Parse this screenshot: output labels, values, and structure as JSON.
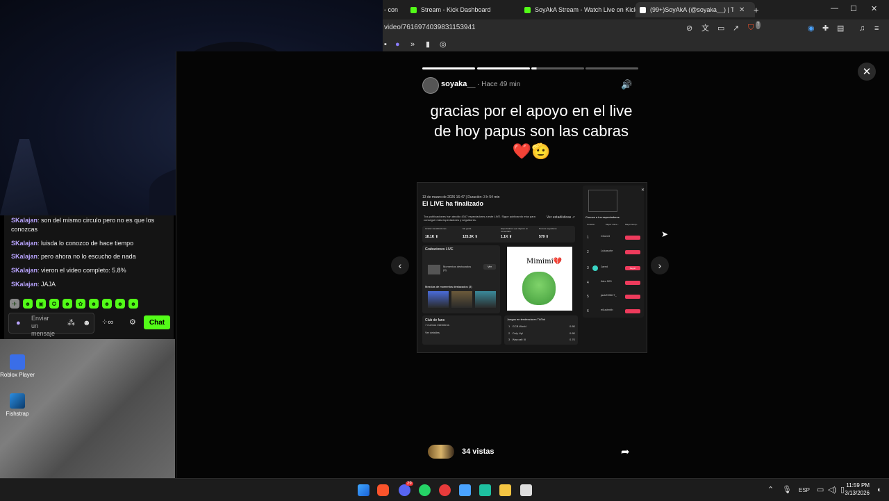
{
  "browser": {
    "tabs": [
      {
        "label": "- con"
      },
      {
        "label": "Stream - Kick Dashboard"
      },
      {
        "label": "SoyAkA Stream - Watch Live on Kick"
      },
      {
        "label": "(99+)SoyAkA (@soyaka__) | TikT"
      }
    ],
    "url": "video/7616974039831153941",
    "shield_badge": "7"
  },
  "chat": {
    "messages": [
      {
        "user": "SKalajan",
        "text": ": son del mismo circulo pero no es que los conozcas"
      },
      {
        "user": "SKalajan",
        "text": ": luisda lo conozco de hace tiempo"
      },
      {
        "user": "SKalajan",
        "text": ": pero ahora no lo escucho de nada"
      },
      {
        "user": "SKalajan",
        "text": ": vieron el video completo: 5.8%"
      },
      {
        "user": "SKalajan",
        "text": ": JAJA"
      }
    ],
    "input_placeholder": "Enviar un mensaje",
    "send_label": "Chat"
  },
  "desktop": {
    "icons": [
      {
        "label": "Roblox Player"
      },
      {
        "label": "Fishstrap"
      }
    ]
  },
  "story": {
    "username": "soyaka__",
    "time": "· Hace 49 min",
    "caption": "gracias por el apoyo en el live de hoy papus son las cabras ❤️🫡",
    "views": "34 vistas",
    "progress": [
      1,
      1,
      0.1,
      0
    ]
  },
  "embedded": {
    "date": "13 de marzo de 2026 16:47 | Duración: 3 h 54 min",
    "title": "El LIVE ha finalizado",
    "summary": "Tus publicaciones han atraído 4347 espectadores a este LIVE. Sigue publicando más para conseguir más espectadores y seguidores.",
    "stats_link": "Ver estadísticas ↗",
    "stats": [
      {
        "label": "Ocultar visualizaciones",
        "value": "18.1K ⬆"
      },
      {
        "label": "Me gusta",
        "value": "125.3K ⬆"
      },
      {
        "label": "Espectadores que dejaron un comentario",
        "value": "1.1K ⬆"
      },
      {
        "label": "Nuevos seguidores",
        "value": "579 ⬆"
      }
    ],
    "recordings_title": "Grabaciones LIVE",
    "moments_label": "Momentos destacados (0)",
    "view_btn": "Ver",
    "mixes_title": "Mezclas de momentos destacados (3)",
    "sticker_text": "Mimimi💔",
    "fans_title": "Club de fans",
    "fans_sub": "7 nuevos miembros",
    "fans_link": "Ver detalles",
    "trending_title": "Juegos en tendencia en TikTok",
    "trending": [
      {
        "rank": "1",
        "name": "GCB World",
        "value": "0.8K"
      },
      {
        "rank": "2",
        "name": "Only Up!",
        "value": "0.8K"
      },
      {
        "rank": "3",
        "name": "Warcraft III",
        "value": "0.7K"
      }
    ],
    "viewers_title": "Conoce a tus espectadores",
    "viewer_tabs": [
      "Corazón",
      "Mayor núme...",
      "Mayor tiemp..."
    ],
    "follow_label": "Seguir",
    "viewers": [
      {
        "rank": "1",
        "name": "Chubet"
      },
      {
        "rank": "2",
        "name": "Lukasurle"
      },
      {
        "rank": "3",
        "name": "Jared"
      },
      {
        "rank": "4",
        "name": "Alex 503"
      },
      {
        "rank": "5",
        "name": "jack290617_"
      },
      {
        "rank": "6",
        "name": "e6usbnbb"
      }
    ]
  },
  "taskbar": {
    "lang": "ESP",
    "time": "11:59 PM",
    "date": "3/13/2026",
    "discord_badge": "29"
  }
}
